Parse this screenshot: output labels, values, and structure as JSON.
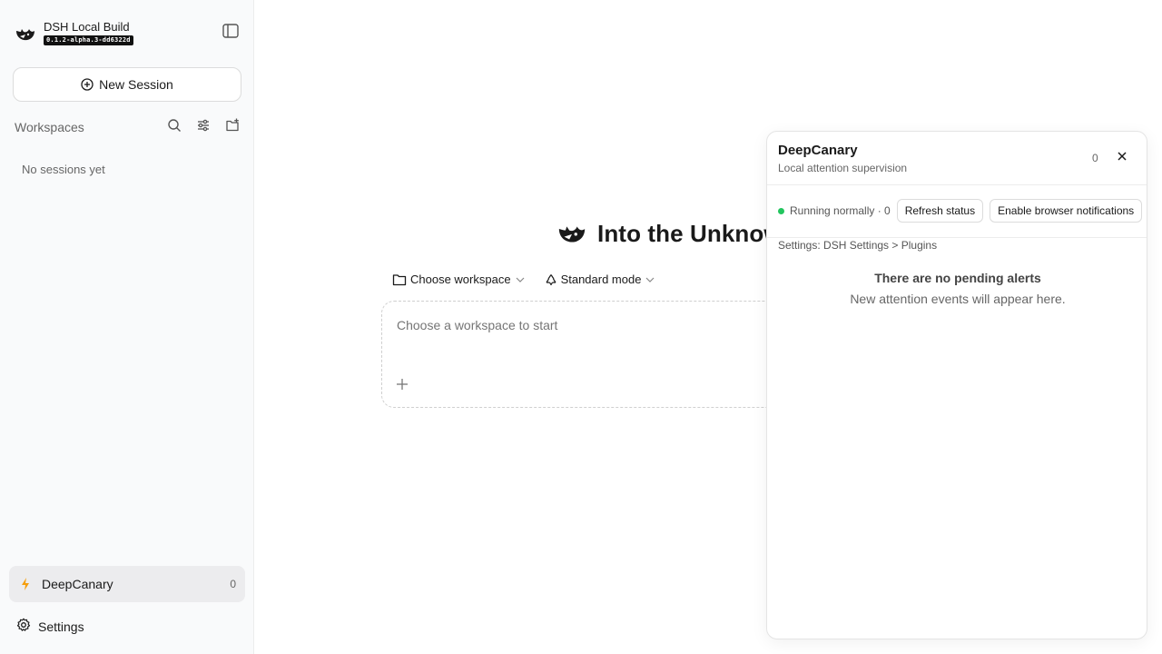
{
  "app": {
    "title": "DSH Local Build",
    "version": "0.1.2-alpha.3-dd6322d"
  },
  "sidebar": {
    "new_session_label": "New Session",
    "workspaces_label": "Workspaces",
    "no_sessions_text": "No sessions yet",
    "deepcanary_label": "DeepCanary",
    "deepcanary_count": "0",
    "settings_label": "Settings"
  },
  "main": {
    "hero_title": "Into the Unknown",
    "choose_workspace_label": "Choose workspace",
    "mode_label": "Standard mode",
    "composer_placeholder": "Choose a workspace to start"
  },
  "panel": {
    "title": "DeepCanary",
    "subtitle": "Local attention supervision",
    "count": "0",
    "status_text": "Running normally · 0",
    "refresh_label": "Refresh status",
    "notifications_label": "Enable browser notifications",
    "settings_path": "Settings: DSH Settings > Plugins",
    "empty_title": "There are no pending alerts",
    "empty_subtitle": "New attention events will appear here."
  },
  "colors": {
    "status_ok": "#22c55e",
    "accent_bolt": "#f59e0b"
  },
  "icons": [
    "whale-logo-icon",
    "sidebar-toggle-icon",
    "plus-circle-icon",
    "search-icon",
    "sliders-icon",
    "folder-plus-icon",
    "bolt-icon",
    "gear-icon",
    "folder-icon",
    "recycle-icon",
    "chevron-down-icon",
    "plus-icon",
    "close-icon"
  ]
}
